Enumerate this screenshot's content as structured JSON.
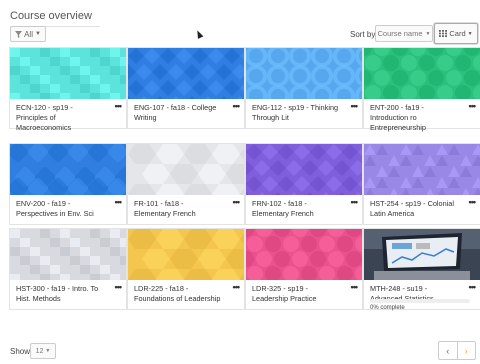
{
  "page": {
    "title": "Course overview"
  },
  "controls": {
    "filter_label": "All",
    "sort_label": "Sort by",
    "sort_value": "Course name",
    "view_label": "Card"
  },
  "courses": [
    {
      "name": "ECN-120 - sp19 - Principles of Macroeconomics",
      "color": "#5de3dc",
      "pattern": "squares"
    },
    {
      "name": "ENG-107 - fa18 - College Writing",
      "color": "#2f7ee0",
      "pattern": "diamonds"
    },
    {
      "name": "ENG-112 - sp19 - Thinking Through Lit",
      "color": "#56a7ee",
      "pattern": "rings"
    },
    {
      "name": "ENT-200 - fa19 - Introduction ro Entrepreneurship",
      "color": "#2bc07d",
      "pattern": "circles"
    },
    {
      "name": "ENV-200 - fa19 - Perspectives in Env. Sci",
      "color": "#2f7ee0",
      "pattern": "soft"
    },
    {
      "name": "FR-101 - fa18 - Elementary French",
      "color": "#e4e6ea",
      "pattern": "hex"
    },
    {
      "name": "FRN-102 - fa18 - Elementary French",
      "color": "#7f5fdc",
      "pattern": "diamonds"
    },
    {
      "name": "HST-254 - sp19 - Colonial Latin America",
      "color": "#9a88e6",
      "pattern": "tri"
    },
    {
      "name": "HST-300 - fa19 - Intro. To Hist. Methods",
      "color": "#d8dae0",
      "pattern": "squares"
    },
    {
      "name": "LDR-225 - fa18 - Foundations of Leadership",
      "color": "#f5c64e",
      "pattern": "hex"
    },
    {
      "name": "LDR-325 - sp19 - Leadership Practice",
      "color": "#e9528c",
      "pattern": "circles"
    },
    {
      "name": "MTH-248 - su19 - Advanced Statistics",
      "color": "#3b4452",
      "pattern": "laptop",
      "progress_percent": 0,
      "progress_label": "0% complete"
    }
  ],
  "footer": {
    "show_label": "Show",
    "show_value": "12"
  },
  "icons": {
    "filter": "filter-icon",
    "grid": "grid-icon",
    "menu": "more-menu-icon",
    "prev": "chevron-left-icon",
    "next": "chevron-right-icon"
  }
}
